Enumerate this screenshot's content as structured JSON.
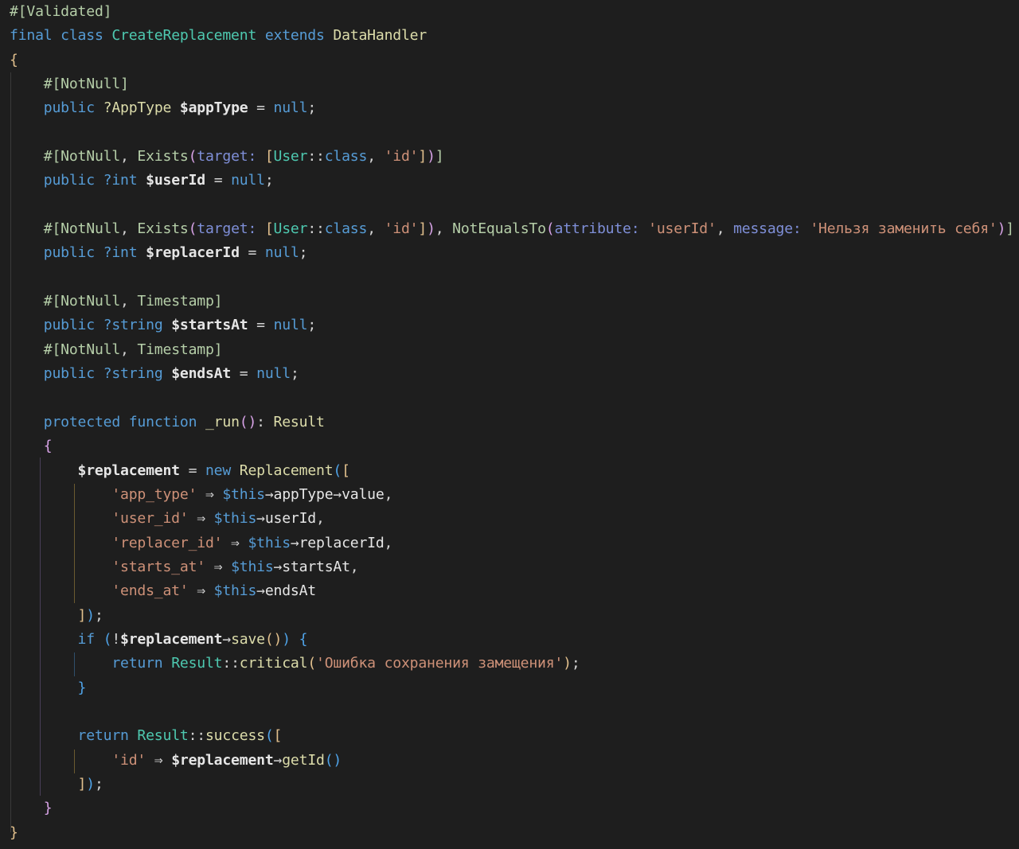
{
  "editor": {
    "theme": {
      "background": "#1e1e1e",
      "keyword": "#569cd6",
      "string": "#ce9178",
      "attribute": "#b5cea8",
      "type": "#4ec9b0",
      "function": "#dcdcaa",
      "variable": "#9cdcfe",
      "param_name": "#7f8fd8"
    },
    "lines": [
      [
        [
          "attr",
          "#["
        ],
        [
          "attr",
          "Validated"
        ],
        [
          "attr",
          "]"
        ]
      ],
      [
        [
          "kw",
          "final"
        ],
        [
          "punc",
          " "
        ],
        [
          "kw",
          "class"
        ],
        [
          "punc",
          " "
        ],
        [
          "type",
          "CreateReplacement"
        ],
        [
          "punc",
          " "
        ],
        [
          "kw",
          "extends"
        ],
        [
          "punc",
          " "
        ],
        [
          "cls",
          "DataHandler"
        ]
      ],
      [
        [
          "br1",
          "{"
        ]
      ],
      [
        [
          "punc",
          "    "
        ],
        [
          "attr",
          "#["
        ],
        [
          "attr",
          "NotNull"
        ],
        [
          "attr",
          "]"
        ]
      ],
      [
        [
          "punc",
          "    "
        ],
        [
          "kw",
          "public"
        ],
        [
          "punc",
          " "
        ],
        [
          "cls",
          "?AppType"
        ],
        [
          "punc",
          " "
        ],
        [
          "var2",
          "$appType"
        ],
        [
          "punc",
          " = "
        ],
        [
          "kw",
          "null"
        ],
        [
          "punc",
          ";"
        ]
      ],
      [],
      [
        [
          "punc",
          "    "
        ],
        [
          "attr",
          "#["
        ],
        [
          "attr",
          "NotNull"
        ],
        [
          "punc",
          ", "
        ],
        [
          "attr",
          "Exists"
        ],
        [
          "br2",
          "("
        ],
        [
          "param",
          "target: "
        ],
        [
          "br1",
          "["
        ],
        [
          "type",
          "User"
        ],
        [
          "punc",
          "::"
        ],
        [
          "kw",
          "class"
        ],
        [
          "punc",
          ", "
        ],
        [
          "str",
          "'id'"
        ],
        [
          "br1",
          "]"
        ],
        [
          "br2",
          ")"
        ],
        [
          "attr",
          "]"
        ]
      ],
      [
        [
          "punc",
          "    "
        ],
        [
          "kw",
          "public"
        ],
        [
          "punc",
          " "
        ],
        [
          "kw",
          "?int"
        ],
        [
          "punc",
          " "
        ],
        [
          "var2",
          "$userId"
        ],
        [
          "punc",
          " = "
        ],
        [
          "kw",
          "null"
        ],
        [
          "punc",
          ";"
        ]
      ],
      [],
      [
        [
          "punc",
          "    "
        ],
        [
          "attr",
          "#["
        ],
        [
          "attr",
          "NotNull"
        ],
        [
          "punc",
          ", "
        ],
        [
          "attr",
          "Exists"
        ],
        [
          "br2",
          "("
        ],
        [
          "param",
          "target: "
        ],
        [
          "br1",
          "["
        ],
        [
          "type",
          "User"
        ],
        [
          "punc",
          "::"
        ],
        [
          "kw",
          "class"
        ],
        [
          "punc",
          ", "
        ],
        [
          "str",
          "'id'"
        ],
        [
          "br1",
          "]"
        ],
        [
          "br2",
          ")"
        ],
        [
          "punc",
          ", "
        ],
        [
          "attr",
          "NotEqualsTo"
        ],
        [
          "br2",
          "("
        ],
        [
          "param",
          "attribute: "
        ],
        [
          "str",
          "'userId'"
        ],
        [
          "punc",
          ", "
        ],
        [
          "param",
          "message: "
        ],
        [
          "str",
          "'Нельзя заменить себя'"
        ],
        [
          "br2",
          ")"
        ],
        [
          "attr",
          "]"
        ]
      ],
      [
        [
          "punc",
          "    "
        ],
        [
          "kw",
          "public"
        ],
        [
          "punc",
          " "
        ],
        [
          "kw",
          "?int"
        ],
        [
          "punc",
          " "
        ],
        [
          "var2",
          "$replacerId"
        ],
        [
          "punc",
          " = "
        ],
        [
          "kw",
          "null"
        ],
        [
          "punc",
          ";"
        ]
      ],
      [],
      [
        [
          "punc",
          "    "
        ],
        [
          "attr",
          "#["
        ],
        [
          "attr",
          "NotNull"
        ],
        [
          "punc",
          ", "
        ],
        [
          "attr",
          "Timestamp"
        ],
        [
          "attr",
          "]"
        ]
      ],
      [
        [
          "punc",
          "    "
        ],
        [
          "kw",
          "public"
        ],
        [
          "punc",
          " "
        ],
        [
          "kw",
          "?string"
        ],
        [
          "punc",
          " "
        ],
        [
          "var2",
          "$startsAt"
        ],
        [
          "punc",
          " = "
        ],
        [
          "kw",
          "null"
        ],
        [
          "punc",
          ";"
        ]
      ],
      [
        [
          "punc",
          "    "
        ],
        [
          "attr",
          "#["
        ],
        [
          "attr",
          "NotNull"
        ],
        [
          "punc",
          ", "
        ],
        [
          "attr",
          "Timestamp"
        ],
        [
          "attr",
          "]"
        ]
      ],
      [
        [
          "punc",
          "    "
        ],
        [
          "kw",
          "public"
        ],
        [
          "punc",
          " "
        ],
        [
          "kw",
          "?string"
        ],
        [
          "punc",
          " "
        ],
        [
          "var2",
          "$endsAt"
        ],
        [
          "punc",
          " = "
        ],
        [
          "kw",
          "null"
        ],
        [
          "punc",
          ";"
        ]
      ],
      [],
      [
        [
          "punc",
          "    "
        ],
        [
          "kw",
          "protected"
        ],
        [
          "punc",
          " "
        ],
        [
          "kw",
          "function"
        ],
        [
          "punc",
          " "
        ],
        [
          "fn",
          "_run"
        ],
        [
          "br2",
          "()"
        ],
        [
          "punc",
          ": "
        ],
        [
          "cls",
          "Result"
        ]
      ],
      [
        [
          "punc",
          "    "
        ],
        [
          "br2",
          "{"
        ]
      ],
      [
        [
          "punc",
          "        "
        ],
        [
          "var2",
          "$replacement"
        ],
        [
          "punc",
          " = "
        ],
        [
          "kw",
          "new"
        ],
        [
          "punc",
          " "
        ],
        [
          "cls",
          "Replacement"
        ],
        [
          "br3",
          "("
        ],
        [
          "br1",
          "["
        ]
      ],
      [
        [
          "punc",
          "            "
        ],
        [
          "str",
          "'app_type'"
        ],
        [
          "punc",
          " ⇒ "
        ],
        [
          "this",
          "$this"
        ],
        [
          "punc",
          "→"
        ],
        [
          "prop",
          "appType"
        ],
        [
          "punc",
          "→"
        ],
        [
          "prop",
          "value"
        ],
        [
          "punc",
          ","
        ]
      ],
      [
        [
          "punc",
          "            "
        ],
        [
          "str",
          "'user_id'"
        ],
        [
          "punc",
          " ⇒ "
        ],
        [
          "this",
          "$this"
        ],
        [
          "punc",
          "→"
        ],
        [
          "prop",
          "userId"
        ],
        [
          "punc",
          ","
        ]
      ],
      [
        [
          "punc",
          "            "
        ],
        [
          "str",
          "'replacer_id'"
        ],
        [
          "punc",
          " ⇒ "
        ],
        [
          "this",
          "$this"
        ],
        [
          "punc",
          "→"
        ],
        [
          "prop",
          "replacerId"
        ],
        [
          "punc",
          ","
        ]
      ],
      [
        [
          "punc",
          "            "
        ],
        [
          "str",
          "'starts_at'"
        ],
        [
          "punc",
          " ⇒ "
        ],
        [
          "this",
          "$this"
        ],
        [
          "punc",
          "→"
        ],
        [
          "prop",
          "startsAt"
        ],
        [
          "punc",
          ","
        ]
      ],
      [
        [
          "punc",
          "            "
        ],
        [
          "str",
          "'ends_at'"
        ],
        [
          "punc",
          " ⇒ "
        ],
        [
          "this",
          "$this"
        ],
        [
          "punc",
          "→"
        ],
        [
          "prop",
          "endsAt"
        ]
      ],
      [
        [
          "punc",
          "        "
        ],
        [
          "br1",
          "]"
        ],
        [
          "br3",
          ")"
        ],
        [
          "punc",
          ";"
        ]
      ],
      [
        [
          "punc",
          "        "
        ],
        [
          "kw",
          "if"
        ],
        [
          "punc",
          " "
        ],
        [
          "br3",
          "("
        ],
        [
          "punc",
          "!"
        ],
        [
          "var2",
          "$replacement"
        ],
        [
          "punc",
          "→"
        ],
        [
          "fn",
          "save"
        ],
        [
          "br1",
          "()"
        ],
        [
          "br3",
          ")"
        ],
        [
          "punc",
          " "
        ],
        [
          "br3",
          "{"
        ]
      ],
      [
        [
          "punc",
          "            "
        ],
        [
          "kw",
          "return"
        ],
        [
          "punc",
          " "
        ],
        [
          "type",
          "Result"
        ],
        [
          "punc",
          "::"
        ],
        [
          "fn",
          "critical"
        ],
        [
          "br1",
          "("
        ],
        [
          "str",
          "'Ошибка сохранения замещения'"
        ],
        [
          "br1",
          ")"
        ],
        [
          "punc",
          ";"
        ]
      ],
      [
        [
          "punc",
          "        "
        ],
        [
          "br3",
          "}"
        ]
      ],
      [],
      [
        [
          "punc",
          "        "
        ],
        [
          "kw",
          "return"
        ],
        [
          "punc",
          " "
        ],
        [
          "type",
          "Result"
        ],
        [
          "punc",
          "::"
        ],
        [
          "fn",
          "success"
        ],
        [
          "br3",
          "("
        ],
        [
          "br1",
          "["
        ]
      ],
      [
        [
          "punc",
          "            "
        ],
        [
          "str",
          "'id'"
        ],
        [
          "punc",
          " ⇒ "
        ],
        [
          "var2",
          "$replacement"
        ],
        [
          "punc",
          "→"
        ],
        [
          "fn",
          "getId"
        ],
        [
          "br3",
          "()"
        ]
      ],
      [
        [
          "punc",
          "        "
        ],
        [
          "br1",
          "]"
        ],
        [
          "br3",
          ")"
        ],
        [
          "punc",
          ";"
        ]
      ],
      [
        [
          "punc",
          "    "
        ],
        [
          "br2",
          "}"
        ]
      ],
      [
        [
          "br1",
          "}"
        ]
      ]
    ]
  }
}
